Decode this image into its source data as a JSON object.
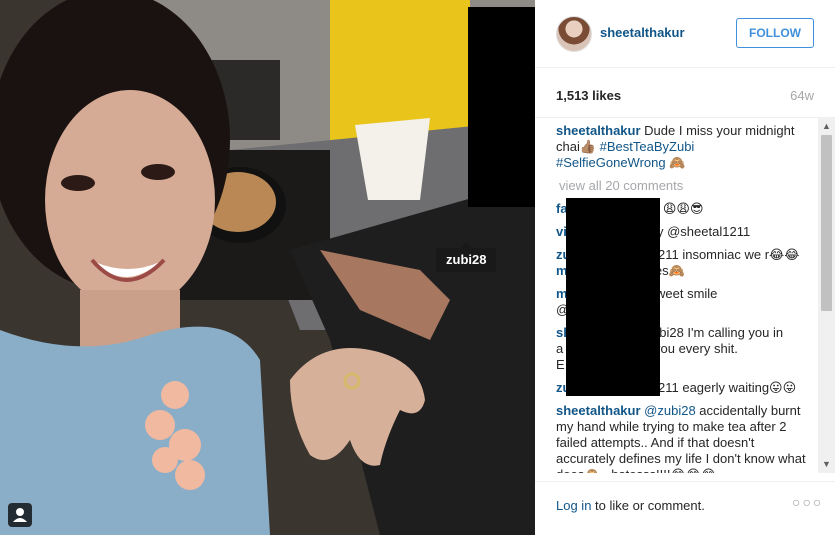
{
  "photo": {
    "user_tag": "zubi28"
  },
  "header": {
    "username": "sheetalthakur",
    "follow_label": "FOLLOW"
  },
  "stats": {
    "likes": "1,513 likes",
    "age": "64w"
  },
  "caption": {
    "username": "sheetalthakur",
    "text": " Dude I miss your midnight chai👍🏽 ",
    "hashtag1": "#BestTeaByZubi",
    "hashtag2": "#SelfieGoneWrong",
    "emoji": " 🙈"
  },
  "view_all": "view all 20 comments",
  "comments": [
    {
      "user": "fa",
      "text": "o 😩😩😎"
    },
    {
      "user": "vi",
      "text": "y @sheetal1211"
    },
    {
      "user": "zu",
      "text_line1": "211 insomniac we r😂😂",
      "text_line2": "m",
      "text_line2b": "ies🙈"
    },
    {
      "user": "m",
      "text_line1": "weet smile",
      "text_line2": "@"
    },
    {
      "user": "sh",
      "text_line1": "ubi28 I'm calling you in",
      "text_line2": "a",
      "text_line2b": " you every shit.",
      "text_line3": "E"
    },
    {
      "user": "zu",
      "text": "211 eagerly waiting😛😛"
    },
    {
      "user": "sheetalthakur",
      "mention": "@zubi28",
      "text": " accidentally burnt my hand while trying to make tea after 2 failed attempts.. And if that doesn't accurately defines my life I don't know what does🙈 . hatesss!!!!😂😂😂"
    }
  ],
  "footer": {
    "login_link": "Log in",
    "login_rest": " to like or comment.",
    "more": "○○○"
  },
  "scroll": {
    "up": "▲",
    "down": "▼"
  },
  "colors": {
    "link_blue": "#125688",
    "follow_blue": "#4090db",
    "muted": "#a5a7aa"
  }
}
